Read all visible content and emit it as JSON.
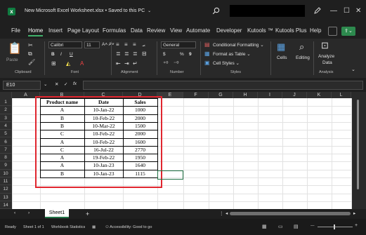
{
  "window": {
    "title": "New Microsoft Excel Worksheet.xlsx • Saved to this PC",
    "title_chevron": "⌄",
    "app_logo": "x",
    "search_icon": "search-icon",
    "pen_icon": "pen-icon",
    "minimize": "—",
    "restore": "☐",
    "close": "✕"
  },
  "tabs": [
    "File",
    "Home",
    "Insert",
    "Page Layout",
    "Formulas",
    "Data",
    "Review",
    "View",
    "Automate",
    "Developer",
    "Kutools ™",
    "Kutools Plus",
    "Help"
  ],
  "active_tab": "Home",
  "ribbon": {
    "clipboard": {
      "label": "Clipboard",
      "paste": "Paste"
    },
    "font": {
      "label": "Font",
      "name": "Calibri",
      "size": "11",
      "bold": "B",
      "italic": "I",
      "underline": "U"
    },
    "alignment": {
      "label": "Alignment"
    },
    "number": {
      "label": "Number",
      "format": "General",
      "currency": "$",
      "percent": "%",
      "comma": "9"
    },
    "styles": {
      "label": "Styles",
      "conditional": "Conditional Formatting ⌄",
      "format_table": "Format as Table ⌄",
      "cell_styles": "Cell Styles ⌄"
    },
    "cells": {
      "label": "Cells"
    },
    "editing": {
      "label": "Editing"
    },
    "analysis": {
      "label": "Analysis",
      "analyze": "Analyze",
      "data": "Data"
    }
  },
  "formula_bar": {
    "name_box": "E10",
    "fx": "fx",
    "cancel": "✕",
    "enter": "✓"
  },
  "columns": [
    "A",
    "B",
    "C",
    "D",
    "E",
    "F",
    "G",
    "H",
    "I",
    "J",
    "K",
    "L"
  ],
  "rows": [
    "1",
    "2",
    "3",
    "4",
    "5",
    "6",
    "7",
    "8",
    "9",
    "10",
    "11",
    "12",
    "13",
    "14"
  ],
  "table": {
    "headers": [
      "Product name",
      "Date",
      "Sales"
    ],
    "rows": [
      [
        "A",
        "10-Jan-22",
        "1000"
      ],
      [
        "B",
        "10-Feb-22",
        "2000"
      ],
      [
        "B",
        "10-Mar-22",
        "1500"
      ],
      [
        "C",
        "10-Feb-22",
        "2000"
      ],
      [
        "A",
        "10-Feb-22",
        "1600"
      ],
      [
        "C",
        "16-Jul-22",
        "2770"
      ],
      [
        "A",
        "19-Feb-22",
        "1950"
      ],
      [
        "A",
        "10-Jan-23",
        "1640"
      ],
      [
        "B",
        "10-Jan-23",
        "1115"
      ]
    ]
  },
  "sheets": [
    "Sheet1"
  ],
  "add_sheet": "+",
  "status": {
    "ready": "Ready",
    "sheet_info": "Sheet 1 of 1",
    "workbook_stats": "Workbook Statistics",
    "accessibility": "Accessibility: Good to go"
  },
  "colors": {
    "accent_green": "#217346",
    "highlight_red": "#e0262f",
    "window_bg": "#1f1f1f"
  }
}
